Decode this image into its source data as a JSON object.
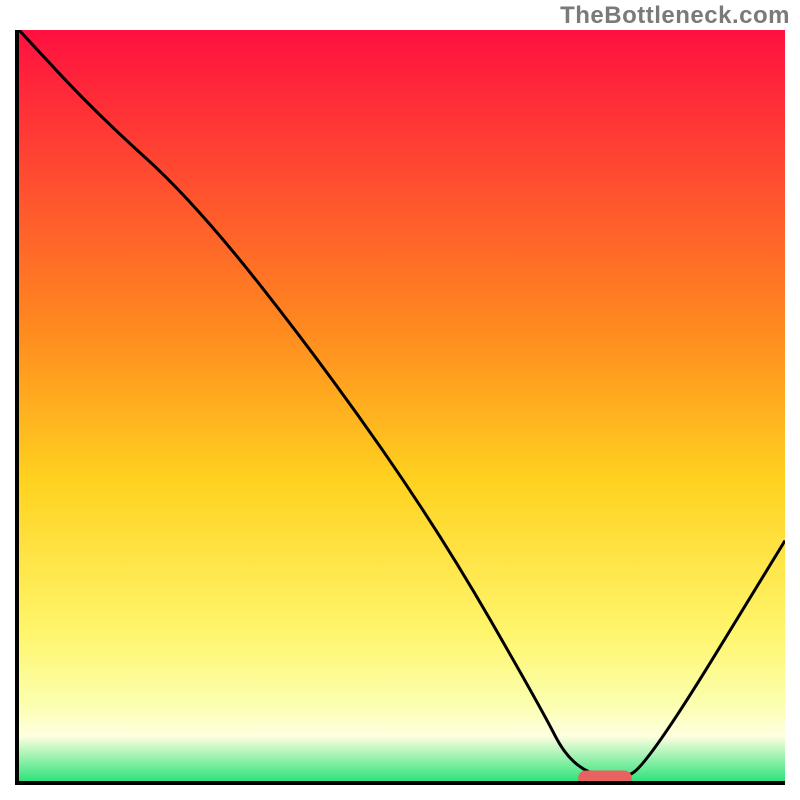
{
  "watermark": "TheBottleneck.com",
  "colors": {
    "top": "#ff1040",
    "mid1": "#ff8a1f",
    "mid2": "#ffd21f",
    "mid3": "#fff56b",
    "mid4": "#fbffb0",
    "thin": "#ffffe0",
    "bottom": "#2ee37a",
    "curve": "#000000",
    "marker": "#e8625f"
  },
  "chart_data": {
    "type": "line",
    "title": "",
    "xlabel": "",
    "ylabel": "",
    "xlim": [
      0,
      100
    ],
    "ylim": [
      0,
      100
    ],
    "series": [
      {
        "name": "bottleneck-curve",
        "x": [
          0,
          10,
          23,
          40,
          55,
          68,
          72,
          78,
          82,
          100
        ],
        "values": [
          100,
          89,
          77,
          55,
          33,
          10,
          2,
          0,
          2,
          32
        ]
      }
    ],
    "marker": {
      "name": "optimal-range",
      "x_start": 73,
      "x_end": 80,
      "y": 0
    },
    "gradient_stops": [
      {
        "offset": 0.0,
        "color_key": "top"
      },
      {
        "offset": 0.4,
        "color_key": "mid1"
      },
      {
        "offset": 0.6,
        "color_key": "mid2"
      },
      {
        "offset": 0.8,
        "color_key": "mid3"
      },
      {
        "offset": 0.9,
        "color_key": "mid4"
      },
      {
        "offset": 0.94,
        "color_key": "thin"
      },
      {
        "offset": 1.0,
        "color_key": "bottom"
      }
    ]
  }
}
